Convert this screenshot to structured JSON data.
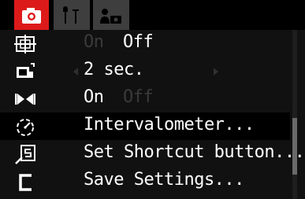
{
  "tabs": [
    {
      "icon": "camera-icon",
      "active": true
    },
    {
      "icon": "wrench-icon",
      "active": false
    },
    {
      "icon": "my-menu-icon",
      "active": false
    }
  ],
  "menu": {
    "rows": [
      {
        "icon": "display-overlay-icon",
        "dim_option": "On",
        "value": "Off"
      },
      {
        "icon": "review-time-icon",
        "value": "2 sec."
      },
      {
        "icon": "stitch-assist-icon",
        "value": "On",
        "dim_option": "Off"
      },
      {
        "icon": "intervalometer-icon",
        "value": "Intervalometer..."
      },
      {
        "icon": "shortcut-button-icon",
        "value": "Set Shortcut button..."
      },
      {
        "icon": "custom-c-icon",
        "value": "Save Settings..."
      }
    ],
    "selected_index": 3
  },
  "colors": {
    "active_tab": "#dd1a1a",
    "inactive_tab": "#3e3e3e",
    "menu_bg": "#111111",
    "selected_row": "#000000",
    "text": "#ffffff",
    "text_dim": "#3a3a3a"
  },
  "scrollbar": {
    "position_fraction": 0.52
  }
}
